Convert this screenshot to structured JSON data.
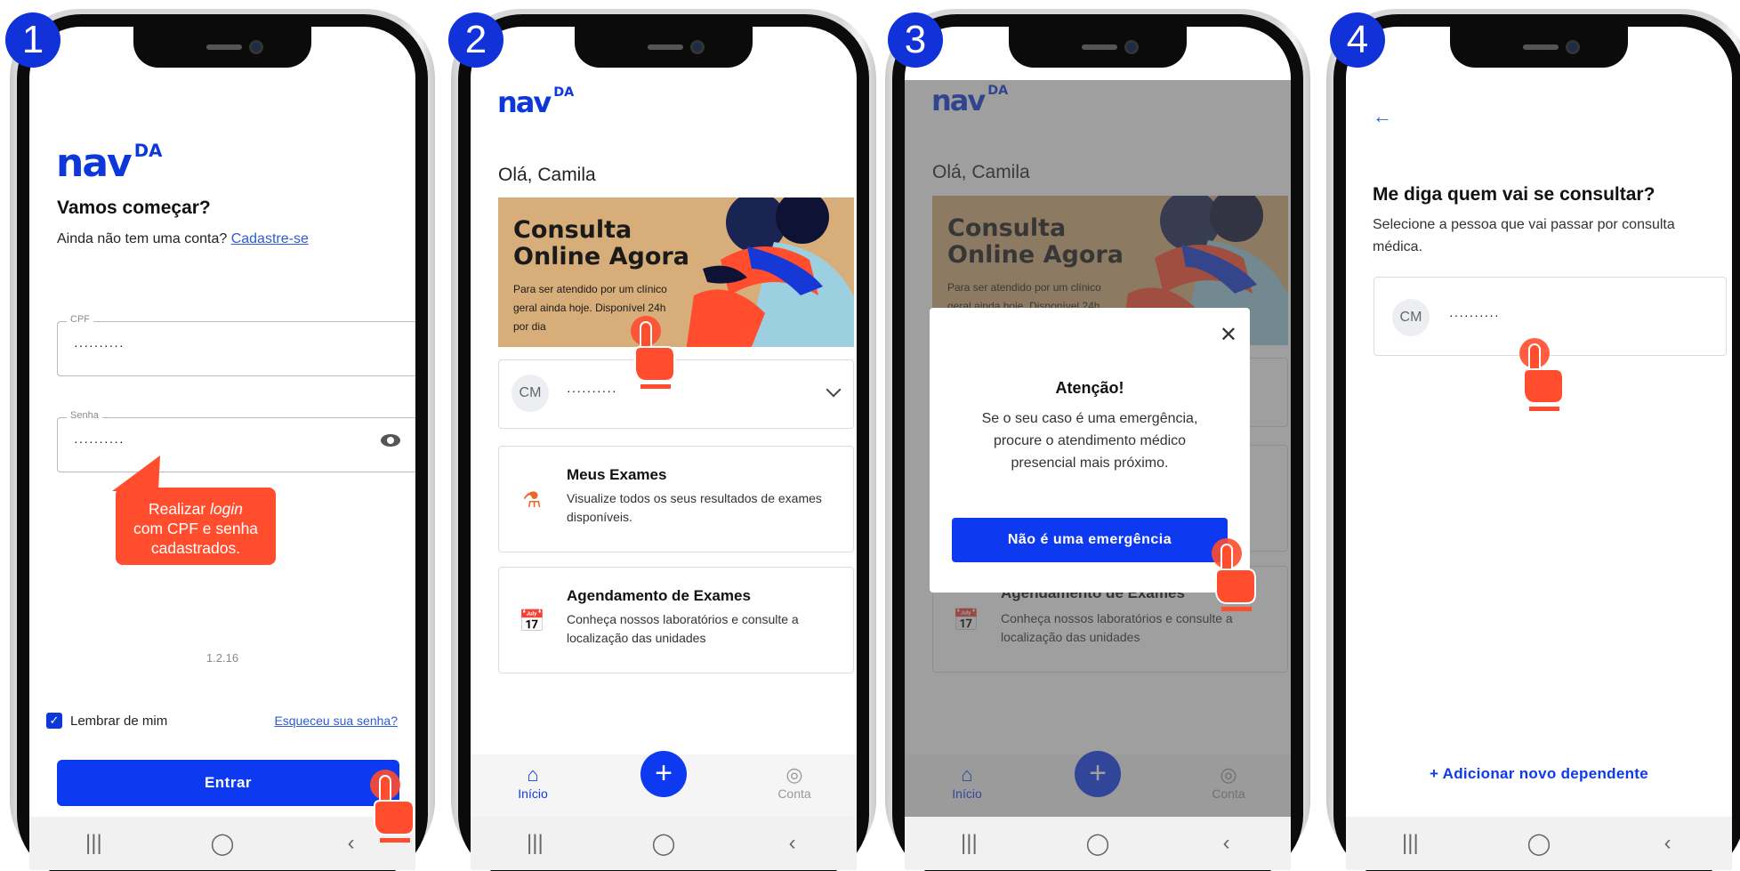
{
  "steps": [
    "1",
    "2",
    "3",
    "4"
  ],
  "logo": {
    "text": "nav",
    "mark": "DA"
  },
  "system_nav": {
    "recents": "|||",
    "home": "◯",
    "back": "‹"
  },
  "screen1": {
    "title": "Vamos começar?",
    "subtitle": "Ainda não tem uma conta?",
    "signup_link": "Cadastre-se",
    "cpf": {
      "label": "CPF",
      "value": "··········"
    },
    "password": {
      "label": "Senha",
      "value": "··········"
    },
    "callout": {
      "prefix": "Realizar ",
      "italic": "login",
      "rest": "com CPF e senha cadastrados."
    },
    "version": "1.2.16",
    "remember_me": "Lembrar de mim",
    "forgot_password": "Esqueceu sua senha?",
    "submit": "Entrar"
  },
  "screen2": {
    "greeting": "Olá, Camila",
    "banner": {
      "title_line1": "Consulta",
      "title_line2": "Online Agora",
      "desc": "Para ser atendido por um clínico geral ainda hoje. Disponível 24h por dia"
    },
    "patient": {
      "initials": "CM",
      "name": "··········"
    },
    "cards": [
      {
        "title": "Meus Exames",
        "desc": "Visualize todos os seus resultados de exames disponíveis.",
        "icon": "flask-icon"
      },
      {
        "title": "Agendamento de Exames",
        "desc": "Conheça nossos laboratórios e consulte a localização das unidades",
        "icon": "calendar-icon"
      }
    ],
    "tabs": {
      "home": "Início",
      "account": "Conta",
      "fab": "+"
    }
  },
  "screen3": {
    "modal": {
      "title": "Atenção!",
      "text": "Se o seu caso é uma emergência, procure o atendimento médico presencial mais próximo.",
      "button": "Não é uma emergência",
      "close": "✕"
    }
  },
  "screen4": {
    "title": "Me diga quem vai se consultar?",
    "subtitle": "Selecione a pessoa que vai passar por consulta médica.",
    "patient": {
      "initials": "CM",
      "name": "··········"
    },
    "add_dependent": "+ Adicionar novo dependente"
  },
  "colors": {
    "brand": "#0d3af0",
    "accent": "#ff4d2e",
    "banner": "#d7ae79"
  }
}
